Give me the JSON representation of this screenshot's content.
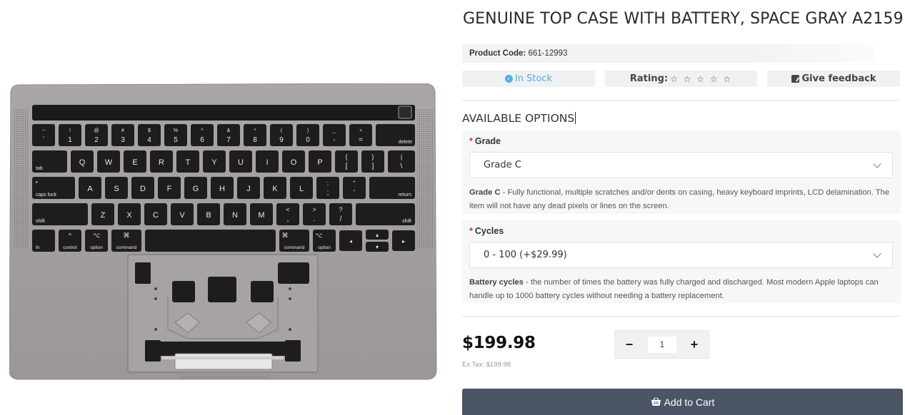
{
  "product": {
    "title": "GENUINE TOP CASE WITH BATTERY, SPACE GRAY A2159",
    "code_label": "Product Code:",
    "code_value": "661-12993",
    "image_icon": "keyboard-top-case-image"
  },
  "meta": {
    "stock_label": "In Stock",
    "stock_icon": "check-circle-icon",
    "rating_label": "Rating:",
    "rating_stars": "☆ ☆ ☆ ☆ ☆",
    "rating_value": 0,
    "rating_max": 5,
    "feedback_label": "Give feedback",
    "feedback_icon": "edit-icon"
  },
  "options": {
    "title": "AVAILABLE OPTIONS",
    "grade": {
      "label": "Grade",
      "required_mark": "*",
      "selected": "Grade C",
      "desc_title": "Grade C",
      "desc_text": " - Fully functional, multiple scratches and/or dents on casing, heavy keyboard imprints, LCD delamination. The item will not have any dead pixels or lines on the screen."
    },
    "cycles": {
      "label": "Cycles",
      "required_mark": "*",
      "selected": "0 - 100 (+$29.99)",
      "desc_title": "Battery cycles",
      "desc_text": " - the number of times the battery was fully charged and discharged. Most modern Apple laptops can handle up to 1000 battery cycles without needing a battery replacement."
    }
  },
  "purchase": {
    "price": "$199.98",
    "ex_tax": "Ex Tax: $199.98",
    "qty_minus": "−",
    "qty_value": "1",
    "qty_plus": "+",
    "cart_label": "Add to Cart",
    "cart_icon": "basket-icon"
  },
  "keyboard": {
    "row1_top": [
      "~",
      "!",
      "@",
      "#",
      "$",
      "%",
      "^",
      "&",
      "*",
      "(",
      ")",
      "_",
      "+"
    ],
    "row1_bottom": [
      "`",
      "1",
      "2",
      "3",
      "4",
      "5",
      "6",
      "7",
      "8",
      "9",
      "0",
      "-",
      "="
    ],
    "row1_end": "delete",
    "row2_start": "tab",
    "row2": [
      "Q",
      "W",
      "E",
      "R",
      "T",
      "Y",
      "U",
      "I",
      "O",
      "P"
    ],
    "row2_sym_top": [
      "{",
      "}",
      "|"
    ],
    "row2_sym_bottom": [
      "[",
      "]",
      "\\"
    ],
    "row3_start": "caps lock",
    "row3": [
      "A",
      "S",
      "D",
      "F",
      "G",
      "H",
      "J",
      "K",
      "L"
    ],
    "row3_sym_top": [
      ":",
      "\""
    ],
    "row3_sym_bottom": [
      ";",
      "'"
    ],
    "row3_end": "return",
    "row4_start": "shift",
    "row4": [
      "Z",
      "X",
      "C",
      "V",
      "B",
      "N",
      "M"
    ],
    "row4_sym_top": [
      "<",
      ">",
      "?"
    ],
    "row4_sym_bottom": [
      ",",
      ".",
      "/"
    ],
    "row4_end": "shift",
    "row5": [
      "fn",
      "control",
      "option",
      "command",
      "command",
      "option"
    ],
    "row5_glyph": [
      "",
      "^",
      "⌥",
      "⌘",
      "⌘",
      "⌥"
    ]
  },
  "colors": {
    "accent_stock": "#4fb0d9",
    "cart_button": "#4b5565",
    "required": "#d9342b",
    "case": "#a29da1",
    "key": "#1d1d1f"
  }
}
